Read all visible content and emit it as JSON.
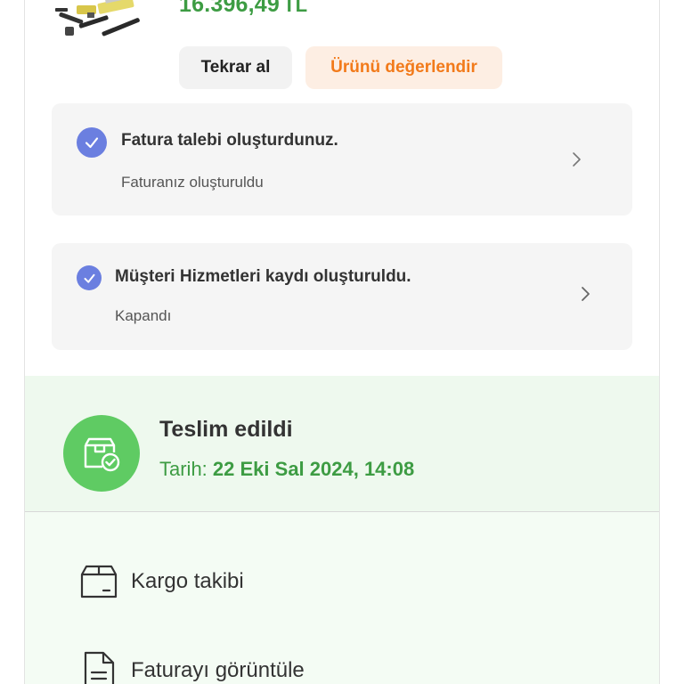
{
  "product": {
    "price": "16.396,49",
    "currency": "TL",
    "image_icon": "product-accessories-image"
  },
  "buttons": {
    "rebuy_label": "Tekrar al",
    "review_label": "Ürünü değerlendir"
  },
  "cards": [
    {
      "title": "Fatura talebi oluşturdunuz.",
      "subtitle": "Faturanız oluşturuldu",
      "icon": "check-icon"
    },
    {
      "title": "Müşteri Hizmetleri kaydı oluşturuldu.",
      "subtitle": "Kapandı",
      "icon": "check-icon"
    }
  ],
  "delivery": {
    "status": "Teslim edildi",
    "date_label": "Tarih:",
    "date_value": "22 Eki Sal 2024, 14:08",
    "icon": "package-delivered-icon"
  },
  "actions": [
    {
      "label": "Kargo takibi",
      "icon": "box-icon"
    },
    {
      "label": "Faturayı görüntüle",
      "icon": "document-icon"
    }
  ],
  "colors": {
    "price_green": "#3d9c43",
    "accent_orange": "#f27a1a",
    "check_blue": "#6b7fe0",
    "delivered_green": "#5fcb63"
  }
}
